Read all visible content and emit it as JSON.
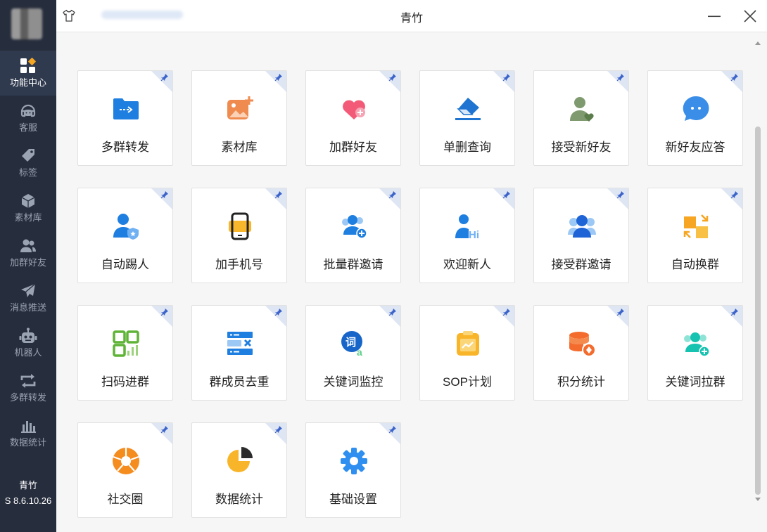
{
  "window": {
    "title": "青竹"
  },
  "sidebar": {
    "items": [
      {
        "label": "功能中心",
        "icon": "grid-icon",
        "active": true
      },
      {
        "label": "客服",
        "icon": "headset-icon"
      },
      {
        "label": "标签",
        "icon": "tag-icon"
      },
      {
        "label": "素材库",
        "icon": "cube-icon"
      },
      {
        "label": "加群好友",
        "icon": "users-icon"
      },
      {
        "label": "消息推送",
        "icon": "paper-plane-icon"
      },
      {
        "label": "机器人",
        "icon": "robot-icon"
      },
      {
        "label": "多群转发",
        "icon": "repeat-icon"
      },
      {
        "label": "数据统计",
        "icon": "bar-chart-icon"
      }
    ],
    "app_name": "青竹",
    "version": "S 8.6.10.26"
  },
  "tiles": [
    {
      "label": "多群转发",
      "icon": "folder-forward-icon"
    },
    {
      "label": "素材库",
      "icon": "image-add-icon"
    },
    {
      "label": "加群好友",
      "icon": "heart-plus-icon"
    },
    {
      "label": "单删查询",
      "icon": "eraser-icon"
    },
    {
      "label": "接受新好友",
      "icon": "user-heart-icon"
    },
    {
      "label": "新好友应答",
      "icon": "chat-bubble-icon"
    },
    {
      "label": "自动踢人",
      "icon": "user-shield-icon"
    },
    {
      "label": "加手机号",
      "icon": "phone-icon"
    },
    {
      "label": "批量群邀请",
      "icon": "group-add-icon"
    },
    {
      "label": "欢迎新人",
      "icon": "user-hi-icon"
    },
    {
      "label": "接受群邀请",
      "icon": "group-icon"
    },
    {
      "label": "自动换群",
      "icon": "swap-icon"
    },
    {
      "label": "扫码进群",
      "icon": "qr-code-icon"
    },
    {
      "label": "群成员去重",
      "icon": "list-dedupe-icon"
    },
    {
      "label": "关键词监控",
      "icon": "keyword-monitor-icon"
    },
    {
      "label": "SOP计划",
      "icon": "clipboard-chart-icon"
    },
    {
      "label": "积分统计",
      "icon": "coin-stack-icon"
    },
    {
      "label": "关键词拉群",
      "icon": "group-plus-icon"
    },
    {
      "label": "社交圈",
      "icon": "aperture-icon"
    },
    {
      "label": "数据统计",
      "icon": "pie-chart-icon"
    },
    {
      "label": "基础设置",
      "icon": "settings-gear-icon"
    }
  ],
  "colors": {
    "sidebar_bg": "#262d3c",
    "sidebar_active": "#303a4e",
    "content_bg": "#f6f6f6",
    "accent_blue": "#1e88e5",
    "accent_orange": "#f39c12"
  }
}
